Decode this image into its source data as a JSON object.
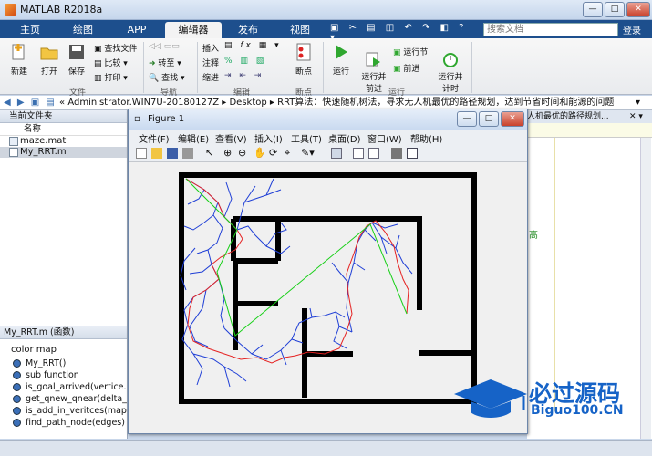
{
  "app": {
    "title": "MATLAB R2018a"
  },
  "tabs": [
    {
      "label": "主页"
    },
    {
      "label": "绘图"
    },
    {
      "label": "APP"
    },
    {
      "label": "编辑器"
    },
    {
      "label": "发布"
    },
    {
      "label": "视图"
    }
  ],
  "search": {
    "placeholder": "搜索文档"
  },
  "login": "登录",
  "ribbon": {
    "file": {
      "new": "新建",
      "open": "打开",
      "save": "保存",
      "find_files": "查找文件",
      "compare": "比较",
      "print": "打印",
      "group": "文件"
    },
    "nav": {
      "goto": "转至",
      "find": "查找",
      "group": "导航"
    },
    "edit": {
      "insert": "插入",
      "comment": "注释",
      "indent": "缩进",
      "fx": "fx",
      "group": "编辑"
    },
    "breakpoints": {
      "label": "断点",
      "group": "断点"
    },
    "run": {
      "run": "运行",
      "run_advance": "运行并\n前进",
      "run_section": "运行节",
      "advance": "前进",
      "run_time": "运行并\n计时",
      "group": "运行"
    }
  },
  "path": {
    "text": "« Administrator.WIN7U-20180127Z ▸ Desktop ▸ RRT算法：快速随机树法，寻求无人机最优的路径规划，达到节省时间和能源的问题"
  },
  "current_folder": {
    "title": "当前文件夹",
    "col_name": "名称",
    "files": [
      {
        "name": "maze.mat"
      },
      {
        "name": "My_RRT.m"
      }
    ]
  },
  "details": {
    "title": "My_RRT.m  (函数)",
    "heading": "color map",
    "items": [
      {
        "label": "My_RRT()"
      },
      {
        "label": "sub function"
      },
      {
        "label": "is_goal_arrived(vertice..."
      },
      {
        "label": "get_qnew_qnear(delta_..."
      },
      {
        "label": "is_add_in_veritces(map..."
      },
      {
        "label": "find_path_node(edges)"
      }
    ]
  },
  "editor_peek": {
    "tab": "人机最优的路径规划...",
    "text": "高"
  },
  "figure": {
    "title": "Figure 1",
    "menu": [
      {
        "label": "文件(F)"
      },
      {
        "label": "编辑(E)"
      },
      {
        "label": "查看(V)"
      },
      {
        "label": "插入(I)"
      },
      {
        "label": "工具(T)"
      },
      {
        "label": "桌面(D)"
      },
      {
        "label": "窗口(W)"
      },
      {
        "label": "帮助(H)"
      }
    ]
  },
  "watermark": {
    "line1": "必过源码",
    "line2": "Biguo100.CN"
  },
  "colors": {
    "tabbar": "#1d4f8d",
    "tree": "#1f3fd6",
    "path": "#e52222",
    "straight": "#19d019",
    "wall": "#000000"
  }
}
